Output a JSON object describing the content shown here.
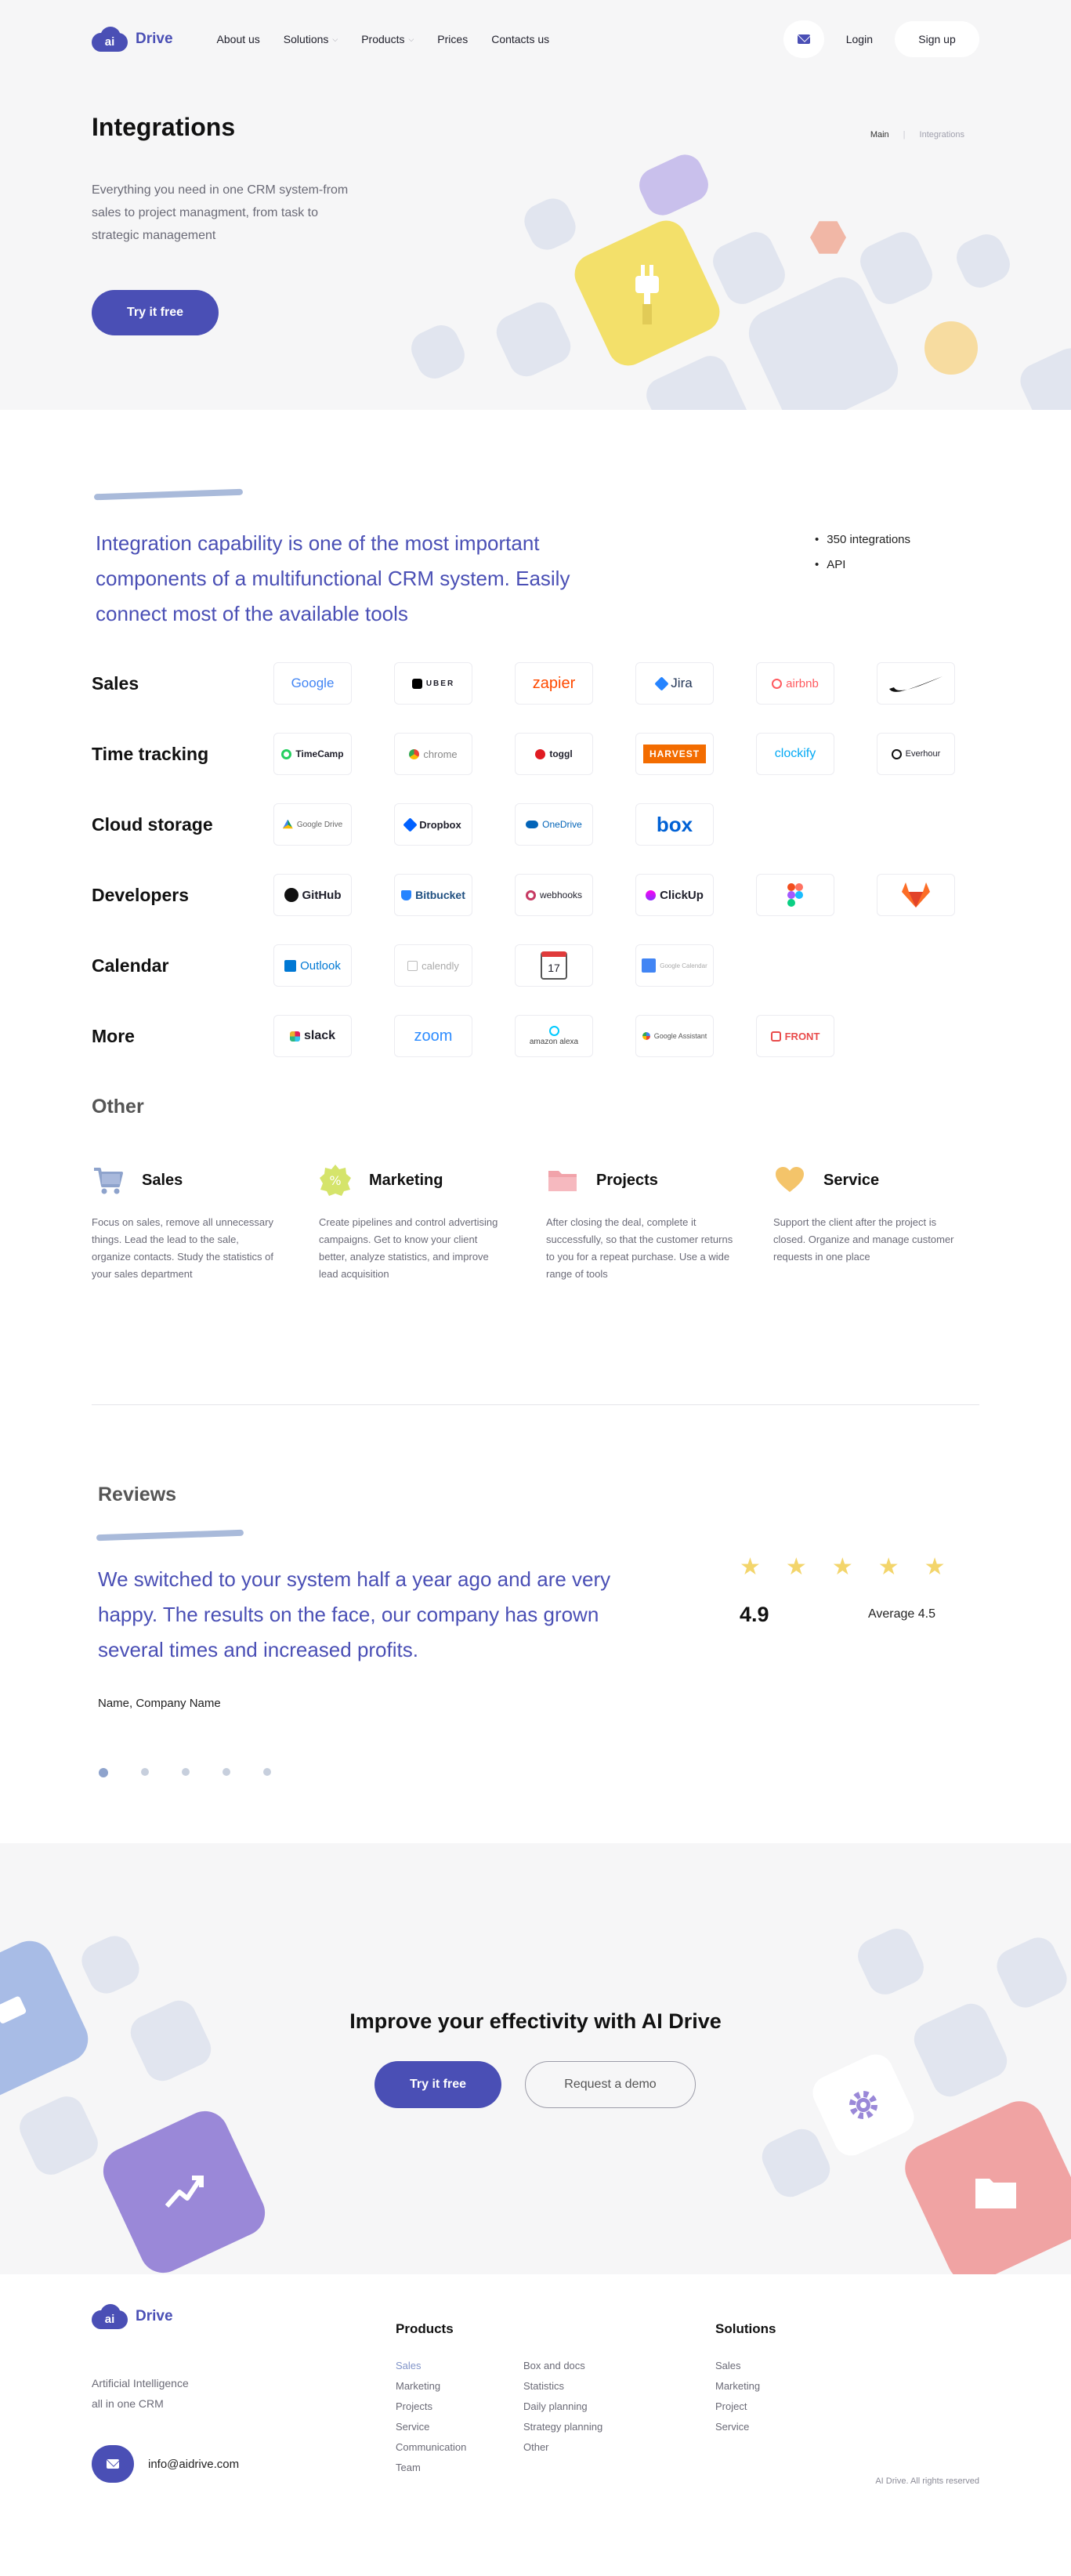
{
  "header": {
    "logo_mark": "ai",
    "logo_text": "Drive",
    "menu": [
      {
        "label": "About us"
      },
      {
        "label": "Solutions"
      },
      {
        "label": "Products"
      },
      {
        "label": "Prices"
      },
      {
        "label": "Contacts us"
      }
    ],
    "login": "Login",
    "signup": "Sign up"
  },
  "hero": {
    "title": "Integrations",
    "breadcrumb": {
      "main": "Main",
      "separator": "|",
      "current": "Integrations"
    },
    "description": "Everything you need in one CRM system-from sales to project managment, from task to strategic management",
    "cta": "Try it free"
  },
  "intro": {
    "text": "Integration capability is one of the most important components of a multifunctional CRM system. Easily connect most of the available tools",
    "bullets": [
      "350 integrations",
      "API"
    ]
  },
  "integrations": [
    {
      "category": "Sales",
      "tools": [
        "Google",
        "UBER",
        "zapier",
        "Jira",
        "airbnb",
        "Nike"
      ]
    },
    {
      "category": "Time tracking",
      "tools": [
        "TimeCamp",
        "chrome",
        "toggl",
        "HARVEST",
        "clockify",
        "Everhour"
      ]
    },
    {
      "category": "Cloud storage",
      "tools": [
        "Google Drive",
        "Dropbox",
        "OneDrive",
        "box"
      ]
    },
    {
      "category": "Developers",
      "tools": [
        "GitHub",
        "Bitbucket",
        "webhooks",
        "ClickUp",
        "Figma",
        "GitLab"
      ]
    },
    {
      "category": "Calendar",
      "tools": [
        "Outlook",
        "calendly",
        "17",
        "Google Calendar"
      ]
    },
    {
      "category": "More",
      "tools": [
        "slack",
        "zoom",
        "amazon alexa",
        "Google Assistant",
        "FRONT"
      ]
    }
  ],
  "other": {
    "title": "Other",
    "cards": [
      {
        "icon": "cart-icon",
        "title": "Sales",
        "text": "Focus on sales, remove all unnecessary things. Lead the lead to the sale, organize contacts. Study the statistics of your sales department"
      },
      {
        "icon": "percent-badge-icon",
        "title": "Marketing",
        "text": "Create pipelines and control advertising campaigns. Get to know your client better, analyze statistics, and improve lead acquisition"
      },
      {
        "icon": "folder-icon",
        "title": "Projects",
        "text": "After closing the deal, complete it successfully, so that the customer returns to you for a repeat purchase. Use a wide range of tools"
      },
      {
        "icon": "heart-icon",
        "title": "Service",
        "text": "Support the client after the project is closed. Organize and manage customer requests in one place"
      }
    ]
  },
  "reviews": {
    "title": "Reviews",
    "text": "We switched to your system half a year ago and are very happy. The results on the face, our company has grown several times and increased profits.",
    "author": "Name, Company Name",
    "rating": 4.9,
    "rating_label": "4.9",
    "stars": 5,
    "average": "Average 4.5",
    "slides": 5,
    "active_slide": 1
  },
  "cta": {
    "title": "Improve your effectivity with AI Drive",
    "primary": "Try it free",
    "secondary": "Request a demo"
  },
  "footer": {
    "tagline_line1": "Artificial Intelligence",
    "tagline_line2": "all in one CRM",
    "email": "info@aidrive.com",
    "products_title": "Products",
    "products_col1": [
      "Sales",
      "Marketing",
      "Projects",
      "Service",
      "Communication",
      "Team"
    ],
    "products_col2": [
      "Box and docs",
      "Statistics",
      "Daily planning",
      "Strategy planning",
      "Other"
    ],
    "solutions_title": "Solutions",
    "solutions": [
      "Sales",
      "Marketing",
      "Project",
      "Service"
    ],
    "copyright": "AI Drive. All rights reserved"
  },
  "colors": {
    "brand": "#4a4fb5",
    "accent_yellow": "#f3e06a",
    "accent_purple": "#9a88d8",
    "accent_pink": "#f0a3a3",
    "tile_grey": "#e1e5ef"
  }
}
